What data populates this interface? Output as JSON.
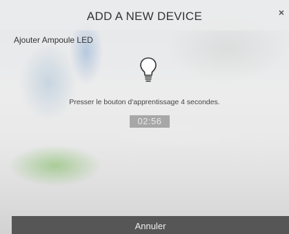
{
  "dialog": {
    "title": "ADD A NEW DEVICE",
    "close_label": "×",
    "subtitle": "Ajouter Ampoule LED",
    "icon": "light-bulb-icon",
    "instruction": "Presser le bouton d'apprentissage 4 secondes.",
    "timer": "02:56",
    "cancel_label": "Annuler"
  },
  "colors": {
    "cancel_bar": "#565656",
    "timer_bg": "#a7a7a7",
    "title_text": "#333333"
  }
}
